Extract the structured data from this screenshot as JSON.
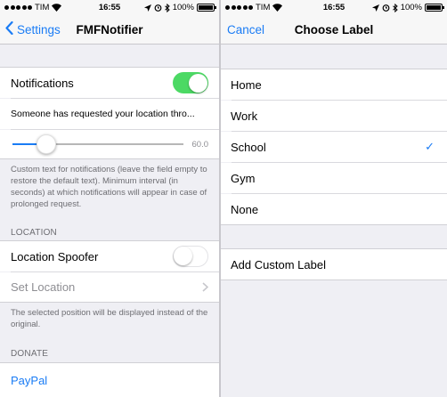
{
  "left": {
    "status": {
      "carrier": "TIM",
      "time": "16:55",
      "battery": "100%",
      "battery_level": 1.0
    },
    "nav": {
      "back_label": "Settings",
      "title": "FMFNotifier"
    },
    "notifications": {
      "label": "Notifications",
      "enabled": true,
      "text_field_value": "Someone has requested your location thro...",
      "slider_value_label": "60.0",
      "slider_fraction": 0.2,
      "footer": "Custom text for notifications (leave the field empty to restore the default text). Minimum interval (in seconds) at which notifications will appear in case of prolonged request."
    },
    "location": {
      "header": "LOCATION",
      "spoofer_label": "Location Spoofer",
      "spoofer_enabled": false,
      "set_location_label": "Set Location",
      "footer": "The selected position will be displayed instead of the original."
    },
    "donate": {
      "header": "DONATE",
      "paypal_label": "PayPal"
    }
  },
  "right": {
    "status": {
      "carrier": "TIM",
      "time": "16:55",
      "battery": "100%",
      "battery_level": 1.0
    },
    "nav": {
      "cancel_label": "Cancel",
      "title": "Choose Label"
    },
    "labels": [
      {
        "label": "Home",
        "selected": false
      },
      {
        "label": "Work",
        "selected": false
      },
      {
        "label": "School",
        "selected": true
      },
      {
        "label": "Gym",
        "selected": false
      },
      {
        "label": "None",
        "selected": false
      }
    ],
    "checkmark": "✓",
    "add_custom_label": "Add Custom Label"
  },
  "colors": {
    "accent": "#1a7cf5",
    "toggle_on": "#4cd964",
    "grouped_bg": "#efeff4"
  },
  "icons": [
    "chevron-left-icon",
    "chevron-right-icon",
    "checkmark-icon",
    "wifi-icon",
    "bluetooth-icon",
    "alarm-icon",
    "location-arrow-icon",
    "battery-icon",
    "signal-dots-icon"
  ]
}
